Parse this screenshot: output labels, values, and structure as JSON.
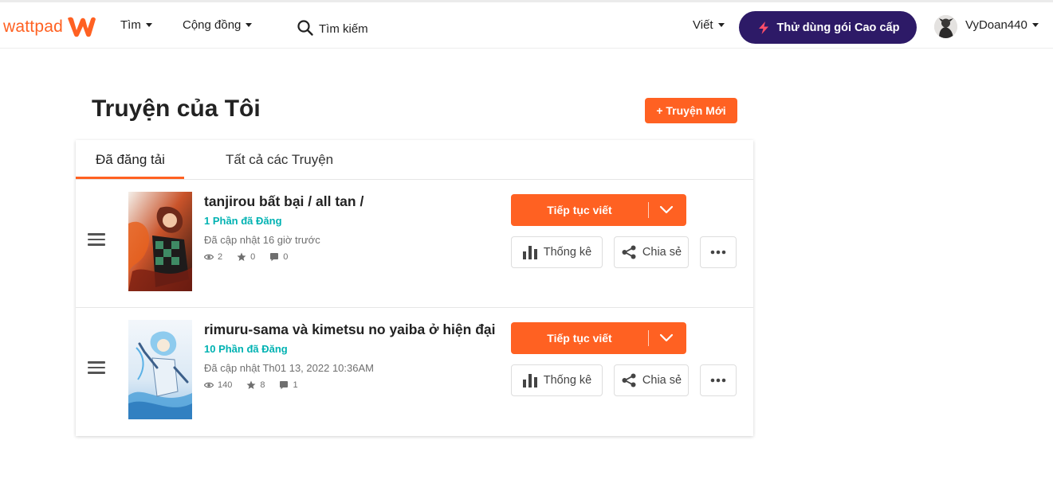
{
  "header": {
    "logo_text": "wattpad",
    "nav": {
      "browse": "Tìm",
      "community": "Cộng đồng"
    },
    "search_placeholder": "Tìm kiếm",
    "write": "Viết",
    "premium": "Thử dùng gói Cao cấp",
    "username": "VyDoan440"
  },
  "page": {
    "title": "Truyện của Tôi",
    "new_story": "+ Truyện Mới"
  },
  "tabs": {
    "published": "Đã đăng tải",
    "all": "Tất cả các Truyện"
  },
  "stories": [
    {
      "title": "tanjirou bất bại / all tan /",
      "parts": "1 Phần đã Đăng",
      "updated": "Đã cập nhật 16 giờ trước",
      "reads": "2",
      "votes": "0",
      "comments": "0"
    },
    {
      "title": "rimuru-sama và kimetsu no yaiba ở hiện đại",
      "parts": "10 Phần đã Đăng",
      "updated": "Đã cập nhật Th01 13, 2022 10:36AM",
      "reads": "140",
      "votes": "8",
      "comments": "1"
    }
  ],
  "actions": {
    "continue_writing": "Tiếp tục viết",
    "stats": "Thống kê",
    "share": "Chia sẻ"
  },
  "colors": {
    "brand_orange": "#ff6122",
    "premium_purple": "#2d1a67",
    "parts_teal": "#00b2b2"
  }
}
